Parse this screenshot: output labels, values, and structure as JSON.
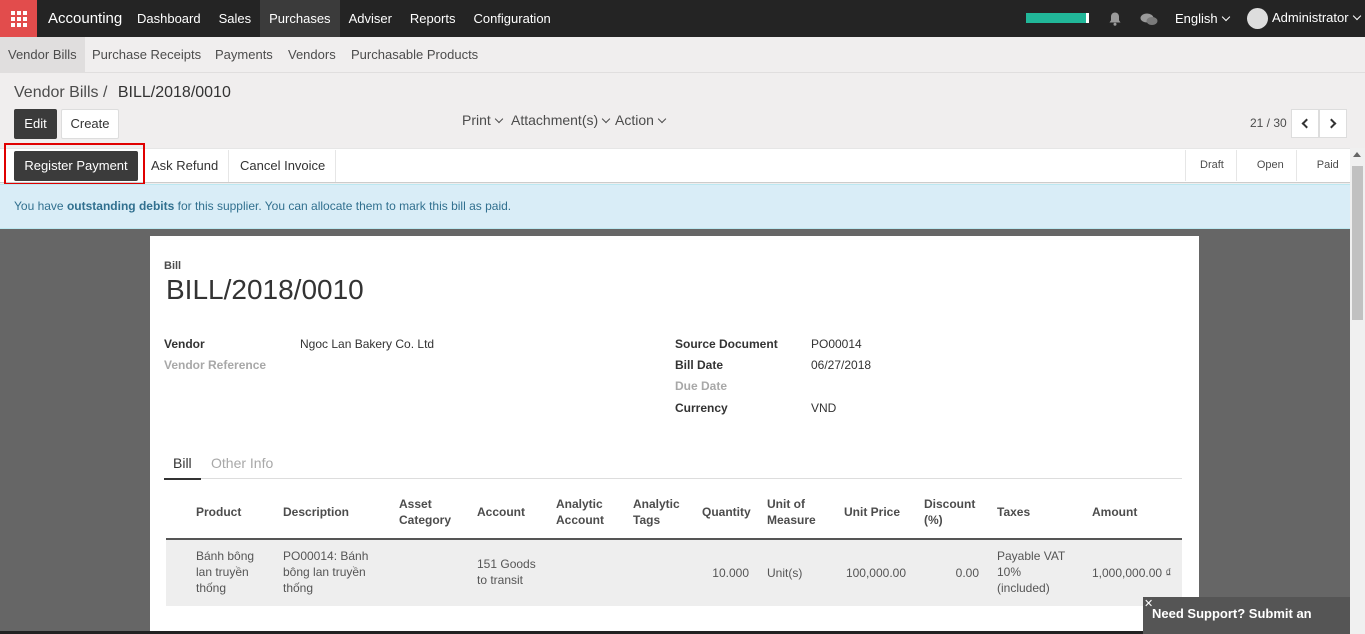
{
  "topbar": {
    "app_name": "Accounting",
    "menu": [
      "Dashboard",
      "Sales",
      "Purchases",
      "Adviser",
      "Reports",
      "Configuration"
    ],
    "active_menu": "Purchases",
    "progress_fraction": 0.95,
    "language": "English",
    "user": "Administrator",
    "accent_color": "#e24c4c",
    "progress_color": "#21b799"
  },
  "submenu": [
    "Vendor Bills",
    "Purchase Receipts",
    "Payments",
    "Vendors",
    "Purchasable Products"
  ],
  "breadcrumb": {
    "parent": "Vendor Bills",
    "separator": "/",
    "current": "BILL/2018/0010"
  },
  "buttons": {
    "edit": "Edit",
    "create": "Create"
  },
  "sidebar_menus": [
    "Print",
    "Attachment(s)",
    "Action"
  ],
  "pager": {
    "value": "21 / 30"
  },
  "status_buttons": {
    "register_payment": "Register Payment",
    "ask_refund": "Ask Refund",
    "cancel_invoice": "Cancel Invoice"
  },
  "stages": [
    "Draft",
    "Open",
    "Paid"
  ],
  "alert": {
    "prefix": "You have ",
    "bold": "outstanding debits",
    "suffix": " for this supplier. You can allocate them to mark this bill as paid."
  },
  "form": {
    "label": "Bill",
    "title": "BILL/2018/0010",
    "fields_left": [
      {
        "label": "Vendor",
        "value": "Ngoc Lan Bakery Co. Ltd"
      },
      {
        "label": "Vendor Reference",
        "value": ""
      }
    ],
    "fields_right": [
      {
        "label": "Source Document",
        "value": "PO00014"
      },
      {
        "label": "Bill Date",
        "value": "06/27/2018"
      },
      {
        "label": "Due Date",
        "value": ""
      },
      {
        "label": "Currency",
        "value": "VND"
      }
    ],
    "tabs": [
      "Bill",
      "Other Info"
    ]
  },
  "table": {
    "headers": {
      "product": "Product",
      "description": "Description",
      "asset_category_1": "Asset",
      "asset_category_2": "Category",
      "account": "Account",
      "analytic_account_1": "Analytic",
      "analytic_account_2": "Account",
      "analytic_tags_1": "Analytic",
      "analytic_tags_2": "Tags",
      "quantity": "Quantity",
      "uom_1": "Unit of",
      "uom_2": "Measure",
      "unit_price": "Unit Price",
      "discount_1": "Discount",
      "discount_2": "(%)",
      "taxes": "Taxes",
      "amount": "Amount"
    },
    "rows": [
      {
        "product": [
          "Bánh bông",
          "lan truyền",
          "thống"
        ],
        "description": [
          "PO00014: Bánh",
          "bông lan truyền",
          "thống"
        ],
        "account": [
          "151 Goods",
          "to transit"
        ],
        "quantity": "10.000",
        "uom": "Unit(s)",
        "unit_price": "100,000.00",
        "discount": "0.00",
        "taxes": [
          "Payable VAT",
          "10%",
          "(included)"
        ],
        "amount": "1,000,000.00 ₫"
      }
    ]
  },
  "support": {
    "close": "✕",
    "text": "Need Support? Submit an Issue."
  }
}
